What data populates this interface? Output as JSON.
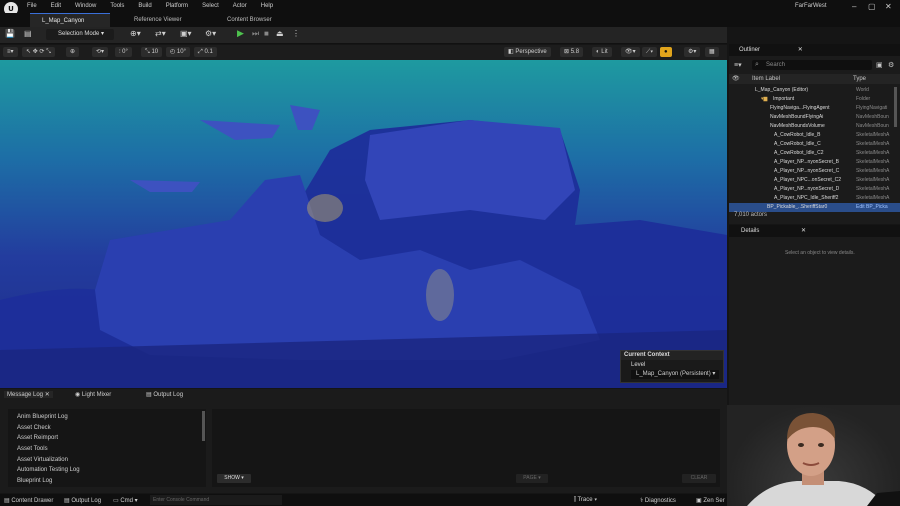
{
  "menu": [
    "File",
    "Edit",
    "Window",
    "Tools",
    "Build",
    "Platform",
    "Select",
    "Actor",
    "Help"
  ],
  "project": "FarFarWest",
  "tabs": [
    "L_Map_Canyon",
    "Reference Viewer",
    "Content Browser"
  ],
  "toolbar": {
    "selection_mode": "Selection Mode"
  },
  "viewport_toolbar": {
    "grid_snap": "0°",
    "snap1": "10",
    "snap2": "10°",
    "snap3": "0.1",
    "perspective": "Perspective",
    "fov": "5.8",
    "lit": "Lit"
  },
  "current_context": {
    "title": "Current Context",
    "level_label": "Level",
    "level_value": "L_Map_Canyon (Persistent)"
  },
  "bottom_tabs": [
    "Message Log",
    "Light Mixer",
    "Output Log"
  ],
  "message_log": {
    "items": [
      "Anim Blueprint Log",
      "Asset Check",
      "Asset Reimport",
      "Asset Tools",
      "Asset Virtualization",
      "Automation Testing Log",
      "Blueprint Log"
    ],
    "show_label": "SHOW",
    "page_label": "PAGE",
    "clear_label": "CLEAR"
  },
  "statusbar": {
    "content_drawer": "Content Drawer",
    "output_log": "Output Log",
    "cmd": "Cmd",
    "console_placeholder": "Enter Console Command",
    "trace": "Trace",
    "diagnostics": "Diagnostics",
    "zen": "Zen Ser"
  },
  "outliner": {
    "title": "Outliner",
    "search_placeholder": "Search",
    "col_label": "Item Label",
    "col_type": "Type",
    "rows": [
      {
        "label": "L_Map_Canyon (Editor)",
        "type": "World"
      },
      {
        "label": "Important",
        "type": "Folder"
      },
      {
        "label": "FlyingNaviga...FlyingAgent",
        "type": "FlyingNavigati"
      },
      {
        "label": "NavMeshBoundFlyingAi",
        "type": "NavMeshBoun"
      },
      {
        "label": "NavMeshBoundsVolume",
        "type": "NavMeshBoun"
      },
      {
        "label": "A_CowRobot_Idle_B",
        "type": "SkeletalMeshA"
      },
      {
        "label": "A_CowRobot_Idle_C",
        "type": "SkeletalMeshA"
      },
      {
        "label": "A_CowRobot_Idle_C2",
        "type": "SkeletalMeshA"
      },
      {
        "label": "A_Player_NP...nyonSecret_B",
        "type": "SkeletalMeshA"
      },
      {
        "label": "A_Player_NP...nyonSecret_C",
        "type": "SkeletalMeshA"
      },
      {
        "label": "A_Player_NPC...onSecret_C2",
        "type": "SkeletalMeshA"
      },
      {
        "label": "A_Player_NP...nyonSecret_D",
        "type": "SkeletalMeshA"
      },
      {
        "label": "A_Player_NPC_Idle_Sheriff2",
        "type": "SkeletalMeshA"
      },
      {
        "label": "BP_Pickable_..SheriffStar0",
        "type": "Edit BP_Picka"
      }
    ],
    "count": "7,010 actors"
  },
  "details": {
    "title": "Details",
    "hint": "Select an object to view details."
  }
}
